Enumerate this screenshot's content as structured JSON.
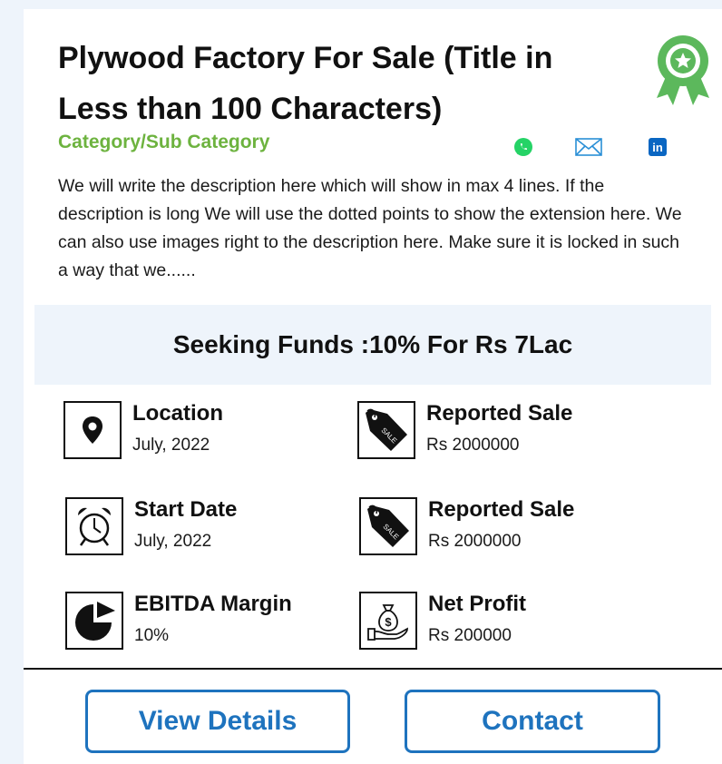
{
  "listing": {
    "title": "Plywood Factory For Sale (Title in Less than 100 Characters)",
    "category": "Category/Sub Category",
    "description": "We will write the description here which will show in max 4 lines. If the description is long We will use the dotted points to show the extension here. We can also use images right to the description here. Make sure it is locked in such a way that we......"
  },
  "share": {
    "icons": [
      "whatsapp-icon",
      "mail-icon",
      "linkedin-icon"
    ],
    "linkedin_text": "in"
  },
  "funding": {
    "text": "Seeking Funds :10% For Rs 7Lac"
  },
  "stats": [
    {
      "label": "Location",
      "value": "July, 2022",
      "icon": "location-pin-icon"
    },
    {
      "label": "Reported Sale",
      "value": "Rs 2000000",
      "icon": "sale-tag-icon"
    },
    {
      "label": "Start Date",
      "value": "July, 2022",
      "icon": "alarm-clock-icon"
    },
    {
      "label": "Reported Sale",
      "value": "Rs 2000000",
      "icon": "sale-tag-icon"
    },
    {
      "label": "EBITDA Margin",
      "value": "10%",
      "icon": "pie-chart-icon"
    },
    {
      "label": "Net Profit",
      "value": "Rs 200000",
      "icon": "money-bag-icon"
    }
  ],
  "icon_text": {
    "sale": "SALE",
    "currency": "$"
  },
  "buttons": {
    "view_details": "View Details",
    "contact": "Contact"
  },
  "colors": {
    "page_bg": "#eef4fb",
    "category": "#6db33f",
    "badge": "#5cb85c",
    "button": "#1e73be",
    "whatsapp": "#25d366",
    "mail": "#2a8fd6",
    "linkedin": "#0a66c2"
  }
}
